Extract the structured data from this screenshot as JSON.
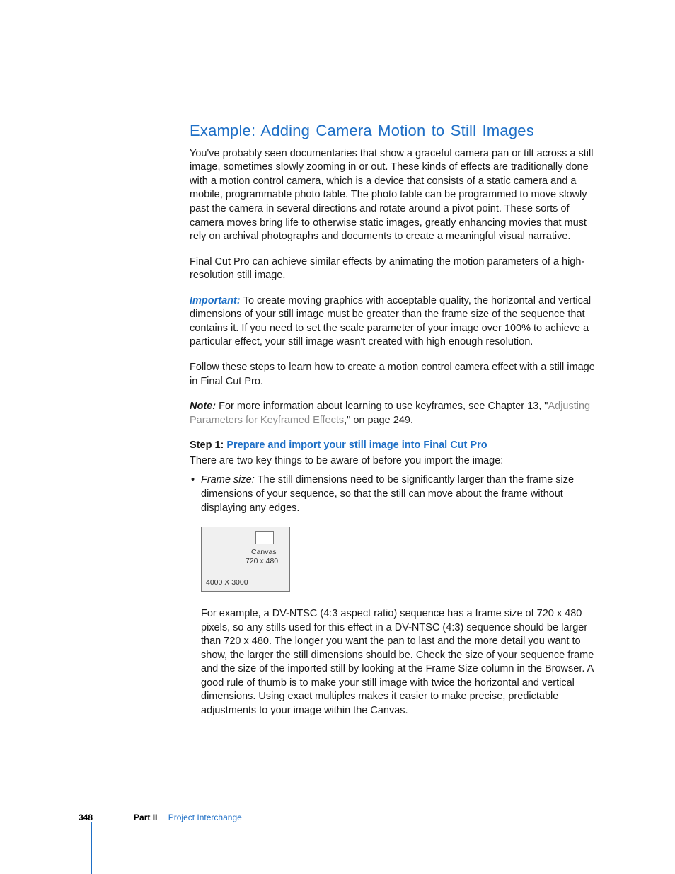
{
  "heading": "Example:  Adding Camera Motion to Still Images",
  "p1": "You've probably seen documentaries that show a graceful camera pan or tilt across a still image, sometimes slowly zooming in or out. These kinds of effects are traditionally done with a motion control camera, which is a device that consists of a static camera and a mobile, programmable photo table. The photo table can be programmed to move slowly past the camera in several directions and rotate around a pivot point. These sorts of camera moves bring life to otherwise static images, greatly enhancing movies that must rely on archival photographs and documents to create a meaningful visual narrative.",
  "p2": "Final Cut Pro can achieve similar effects by animating the motion parameters of a high-resolution still image.",
  "important_label": "Important:  ",
  "p3": "To create moving graphics with acceptable quality, the horizontal and vertical dimensions of your still image must be greater than the frame size of the sequence that contains it. If you need to set the scale parameter of your image over 100% to achieve a particular effect, your still image wasn't created with high enough resolution.",
  "p4": "Follow these steps to learn how to create a motion control camera effect with a still image in Final Cut Pro.",
  "note_label": "Note:  ",
  "p5a": "For more information about learning to use keyframes, see Chapter 13, \"",
  "p5link": "Adjusting Parameters for Keyframed Effects",
  "p5b": ",\" on page 249.",
  "step_label": "Step 1:  ",
  "step_title": "Prepare and import your still image into Final Cut Pro",
  "p6": "There are two key things to be aware of before you import the image:",
  "bullet_term": "Frame size:  ",
  "bullet_text": "The still dimensions need to be significantly larger than the frame size dimensions of your sequence, so that the still can move about the frame without displaying any edges.",
  "diagram": {
    "canvas_label": "Canvas",
    "canvas_dim": "720 x 480",
    "outer_dim": "4000 X 3000"
  },
  "p7": "For example, a DV-NTSC (4:3 aspect ratio) sequence has a frame size of 720 x 480 pixels, so any stills used for this effect in a DV-NTSC (4:3) sequence should be larger than 720 x 480. The longer you want the pan to last and the more detail you want to show, the larger the still dimensions should be. Check the size of your sequence frame and the size of the imported still by looking at the Frame Size column in the Browser. A good rule of thumb is to make your still image with twice the horizontal and vertical dimensions. Using exact multiples makes it easier to make precise, predictable adjustments to your image within the Canvas.",
  "footer": {
    "page": "348",
    "part_label": "Part II",
    "part_title": "Project Interchange"
  }
}
